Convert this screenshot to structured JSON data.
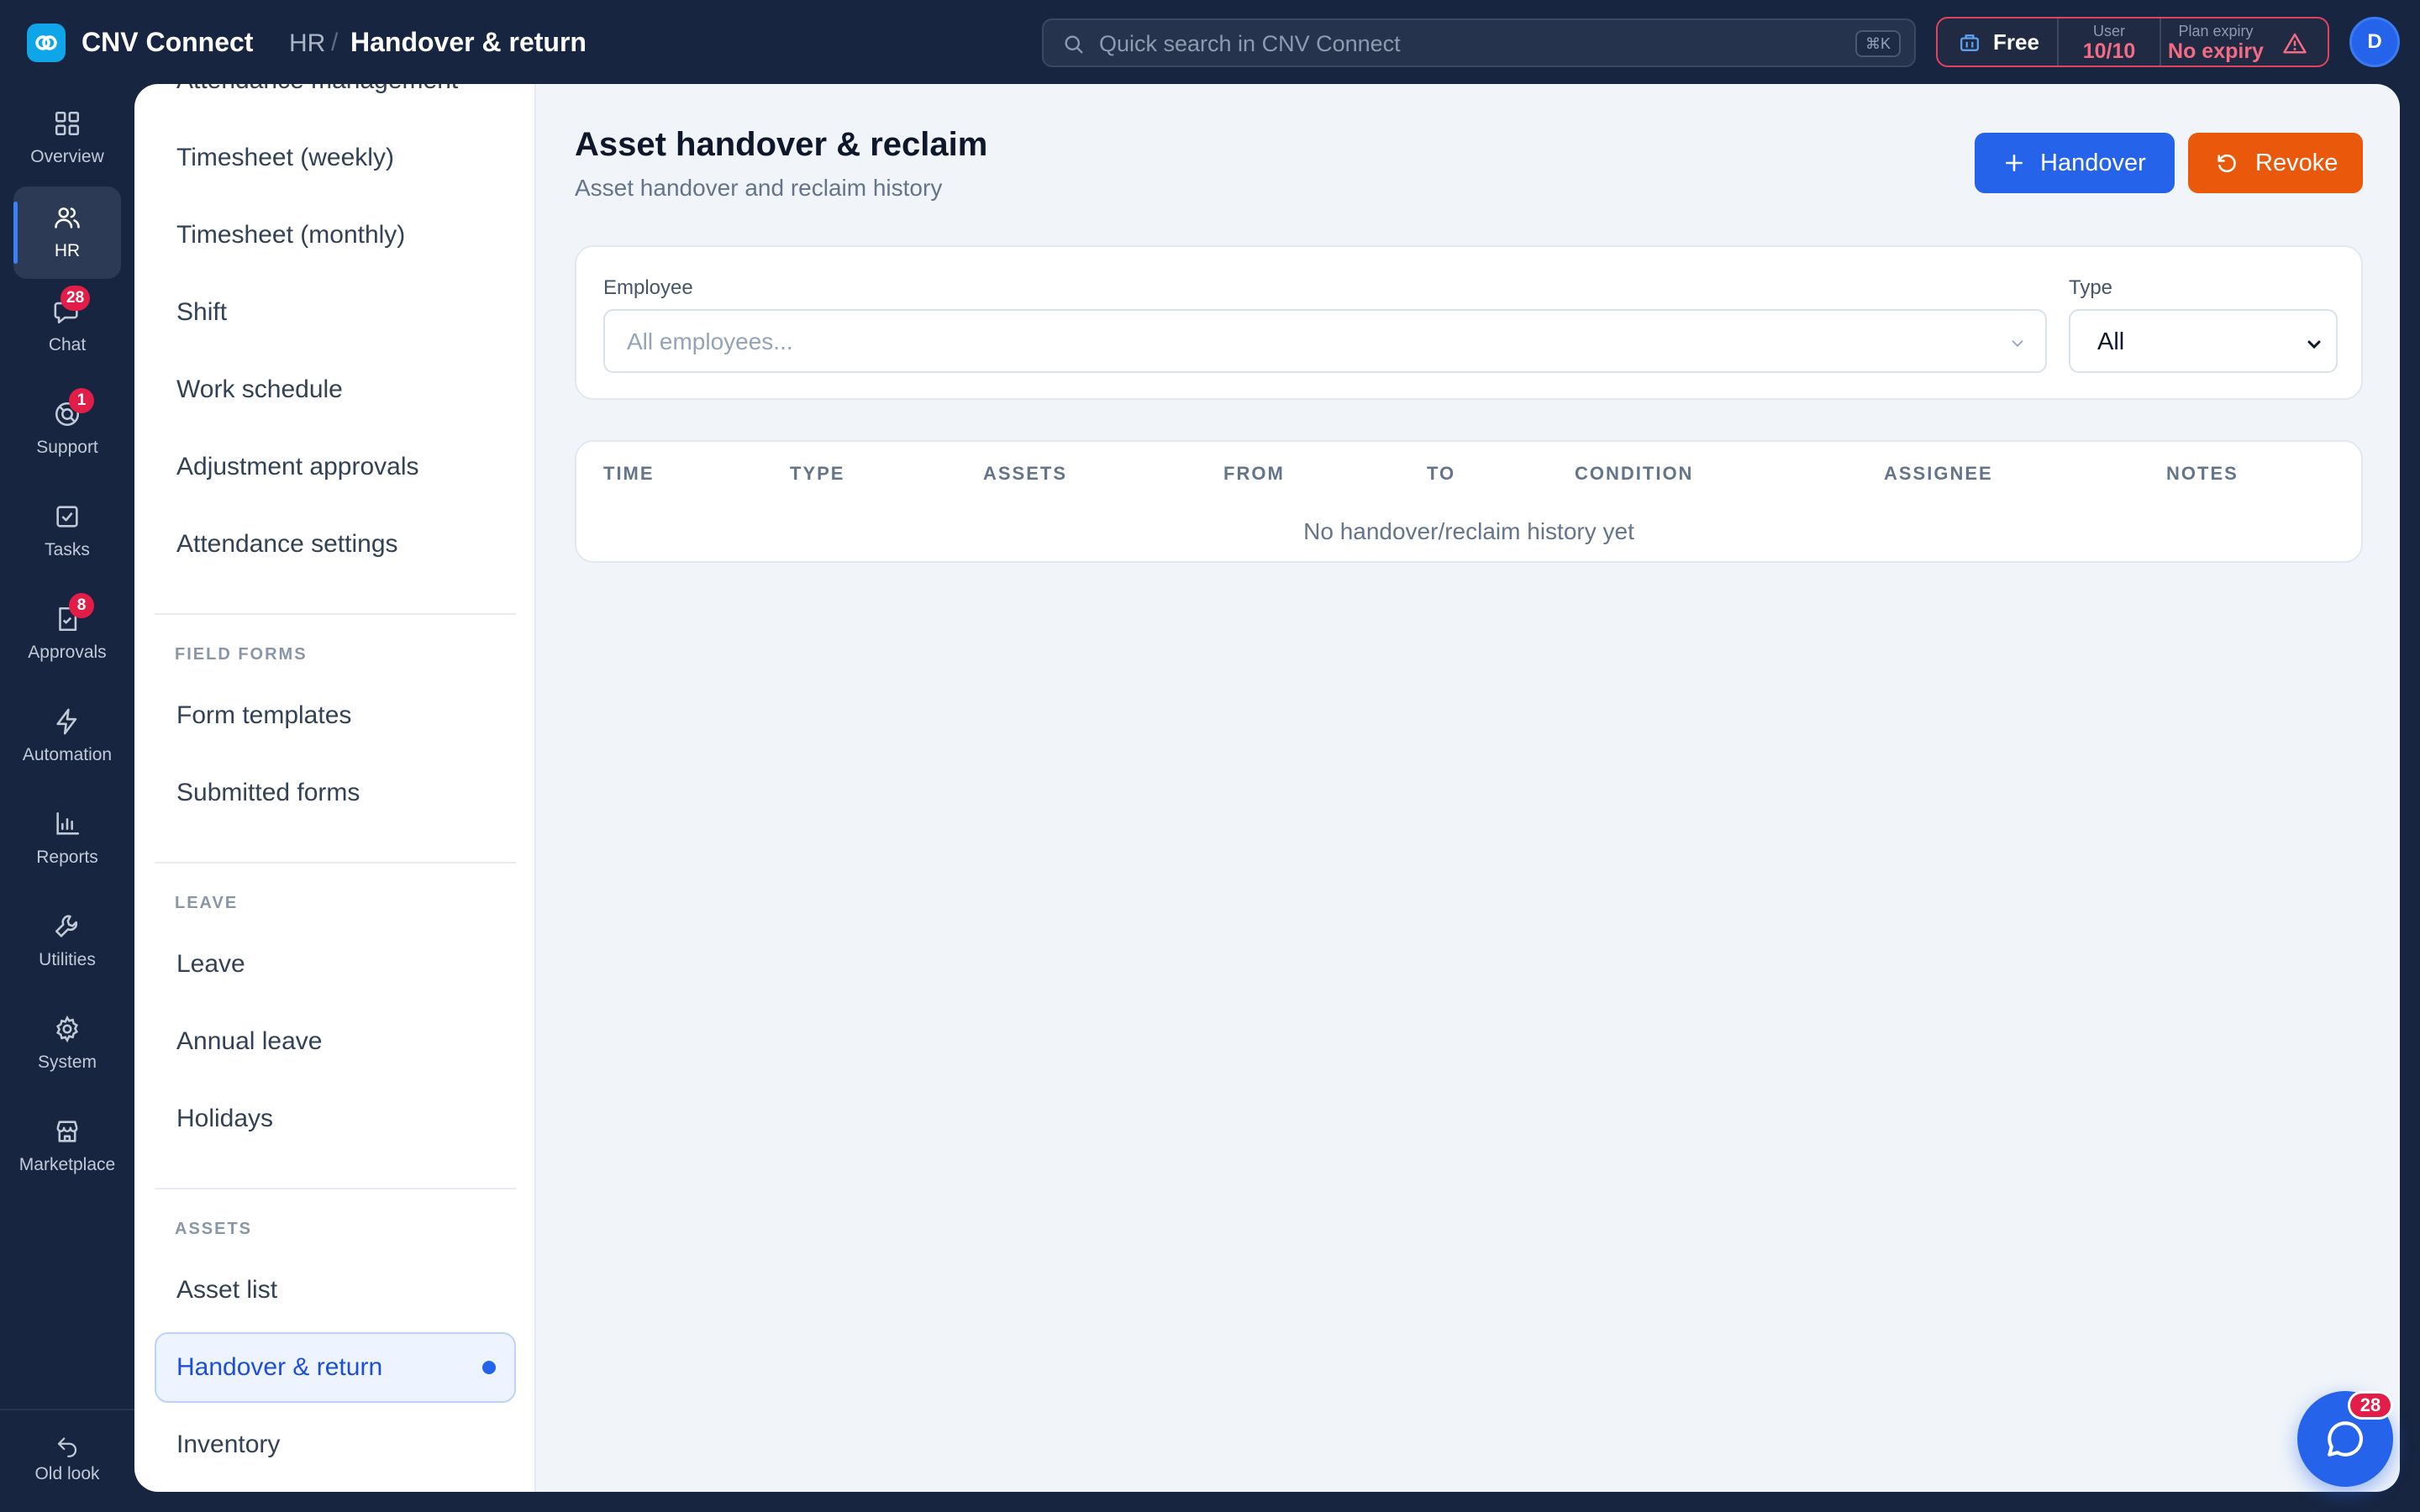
{
  "app": {
    "name": "CNV Connect"
  },
  "breadcrumb": {
    "section": "HR",
    "separator": "/",
    "current": "Handover & return"
  },
  "search": {
    "placeholder": "Quick search in CNV Connect",
    "shortcut": "⌘K"
  },
  "plan": {
    "name": "Free",
    "user_label": "User",
    "user_value": "10/10",
    "expiry_label": "Plan expiry",
    "expiry_value": "No expiry"
  },
  "user": {
    "initial": "D"
  },
  "rail": {
    "items": [
      {
        "label": "Overview",
        "icon": "grid-icon"
      },
      {
        "label": "HR",
        "icon": "users-icon",
        "active": true
      },
      {
        "label": "Chat",
        "icon": "chat-icon",
        "badge": "28"
      },
      {
        "label": "Support",
        "icon": "support-icon",
        "badge": "1"
      },
      {
        "label": "Tasks",
        "icon": "task-check-icon"
      },
      {
        "label": "Approvals",
        "icon": "approval-icon",
        "badge": "8"
      },
      {
        "label": "Automation",
        "icon": "lightning-icon"
      },
      {
        "label": "Reports",
        "icon": "bar-chart-icon"
      },
      {
        "label": "Utilities",
        "icon": "wrench-icon"
      },
      {
        "label": "System",
        "icon": "gear-icon"
      },
      {
        "label": "Marketplace",
        "icon": "store-icon"
      }
    ],
    "footer": {
      "label": "Old look",
      "icon": "undo-icon"
    }
  },
  "subnav": {
    "partial_item": "Attendance management",
    "attendance_items": [
      "Timesheet (weekly)",
      "Timesheet (monthly)",
      "Shift",
      "Work schedule",
      "Adjustment approvals",
      "Attendance settings"
    ],
    "field_forms": {
      "title": "FIELD FORMS",
      "items": [
        "Form templates",
        "Submitted forms"
      ]
    },
    "leave": {
      "title": "LEAVE",
      "items": [
        "Leave",
        "Annual leave",
        "Holidays"
      ]
    },
    "assets": {
      "title": "ASSETS",
      "items": [
        "Asset list",
        "Handover & return",
        "Inventory"
      ]
    }
  },
  "page": {
    "title": "Asset handover & reclaim",
    "subtitle": "Asset handover and reclaim history",
    "handover_button": "Handover",
    "revoke_button": "Revoke"
  },
  "filters": {
    "employee_label": "Employee",
    "employee_placeholder": "All employees...",
    "type_label": "Type",
    "type_value": "All"
  },
  "table": {
    "columns": [
      "TIME",
      "TYPE",
      "ASSETS",
      "FROM",
      "TO",
      "CONDITION",
      "ASSIGNEE",
      "NOTES"
    ],
    "empty_text": "No handover/reclaim history yet"
  },
  "chat_fab": {
    "badge": "28"
  },
  "colors": {
    "sidebar_bg": "#172540",
    "primary": "#2563eb",
    "revoke": "#ea580c",
    "badge": "#e11d48"
  }
}
